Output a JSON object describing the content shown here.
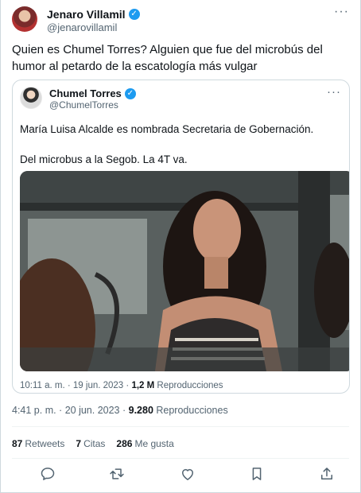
{
  "tweet": {
    "author_name": "Jenaro Villamil",
    "author_handle": "@jenarovillamil",
    "text": "Quien es Chumel Torres? Alguien que fue del microbús del humor al petardo de la escatología más vulgar",
    "time": "4:41 p. m. · 20 jun. 2023 · ",
    "views_count": "9.280",
    "views_label": " Reproducciones"
  },
  "quote": {
    "author_name": "Chumel Torres",
    "author_handle": "@ChumelTorres",
    "text": "María Luisa Alcalde es nombrada Secretaria de Gobernación.\n\nDel microbus a la Segob. La 4T va.",
    "time": "10:11 a. m. · 19 jun. 2023 · ",
    "views_count": "1,2 M",
    "views_label": " Reproducciones"
  },
  "stats": {
    "retweets_count": "87",
    "retweets_label": "Retweets",
    "quotes_count": "7",
    "quotes_label": "Citas",
    "likes_count": "286",
    "likes_label": "Me gusta"
  },
  "icons": {
    "verified": "verified-badge-icon",
    "more": "more-options-icon",
    "reply": "reply-icon",
    "retweet": "retweet-icon",
    "like": "like-icon",
    "bookmark": "bookmark-icon",
    "share": "share-icon"
  },
  "colors": {
    "accent": "#1d9bf0",
    "text_primary": "#0f1419",
    "text_secondary": "#536471",
    "border": "#cfd9de"
  }
}
